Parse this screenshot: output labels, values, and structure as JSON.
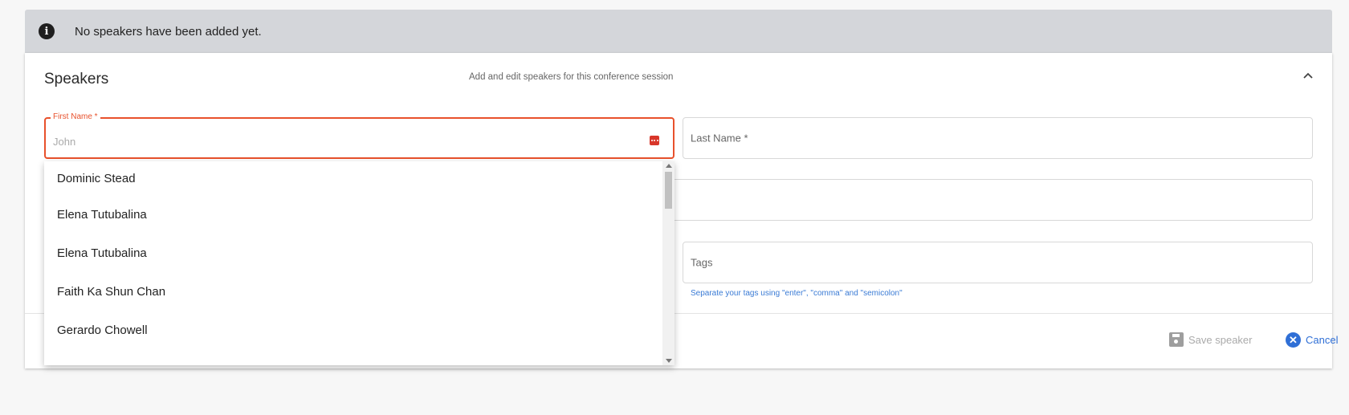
{
  "alert": {
    "icon": "info-icon",
    "message": "No speakers have been added yet."
  },
  "card": {
    "title": "Speakers",
    "subtitle": "Add and edit speakers for this conference session",
    "collapse_icon": "chevron-up-icon"
  },
  "form": {
    "first_name": {
      "label": "First Name *",
      "placeholder": "John",
      "value": ""
    },
    "last_name": {
      "label": "Last Name *"
    },
    "tags": {
      "label": "Tags",
      "hint": "Separate your tags using \"enter\", \"comma\" and \"semicolon\""
    }
  },
  "autocomplete": {
    "options": [
      "Dominic Stead",
      "Elena Tutubalina",
      "Elena Tutubalina",
      "Faith Ka Shun Chan",
      "Gerardo Chowell"
    ]
  },
  "actions": {
    "save_label": "Save speaker",
    "cancel_label": "Cancel"
  },
  "colors": {
    "accent_error": "#e8512c",
    "link_blue": "#2f6fd6",
    "alert_bg": "#d4d6da"
  }
}
